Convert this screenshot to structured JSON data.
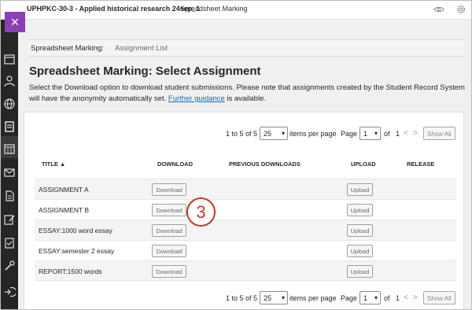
{
  "topbar": {
    "course_title": "UPHPKC-30-3 - Applied historical research 24sep_1",
    "page_tab": "Spreadsheet Marking",
    "icons": [
      "preview-eye-icon",
      "settings-gear-icon"
    ]
  },
  "leftnav": {
    "close_label": "✕",
    "items": [
      "calendar-grid-icon",
      "people-icon",
      "globe-icon",
      "spreadsheet-icon",
      "calendar-icon",
      "mail-icon",
      "document-icon",
      "edit-icon",
      "grades-icon",
      "tools-icon",
      "logout-icon"
    ]
  },
  "breadcrumb": {
    "root": "Spreadsheet Marking:",
    "current": "Assignment List"
  },
  "page": {
    "title": "Spreadsheet Marking: Select Assignment",
    "instructions_text": "Select the Download option to download student submissions. Please note that assignments created by the Student Record System will have the anonymity automatically set.",
    "guidance_link": "Further guidance",
    "instructions_suffix": "is available."
  },
  "pager": {
    "range": "1 to 5 of 5",
    "per_page_value": "25",
    "per_page_label": "items per page",
    "page_label": "Page",
    "page_value": "1",
    "of_label": "of",
    "total_pages": "1",
    "prev": "<",
    "next": ">",
    "show_all": "Show All"
  },
  "table": {
    "headers": {
      "title": "TITLE ▲",
      "download": "DOWNLOAD",
      "previous_downloads": "PREVIOUS DOWNLOADS",
      "upload": "UPLOAD",
      "release": "RELEASE"
    },
    "download_label": "Download",
    "upload_label": "Upload",
    "rows": [
      {
        "title": "ASSIGNMENT A"
      },
      {
        "title": "ASSIGNMENT B"
      },
      {
        "title": "ESSAY:1000 word essay"
      },
      {
        "title": "ESSAY:semester 2 essay"
      },
      {
        "title": "REPORT:1500 words"
      }
    ]
  },
  "annotation": {
    "step_number": "3"
  },
  "colors": {
    "accent_purple": "#8b3fb5",
    "nav_dark": "#262626",
    "link_blue": "#1a67c2",
    "badge_red": "#c0392b"
  }
}
